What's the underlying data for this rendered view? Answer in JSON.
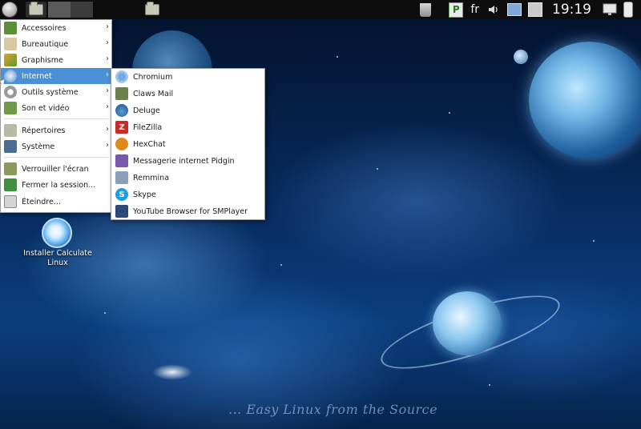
{
  "taskbar": {
    "language": "fr",
    "clock": "19:19"
  },
  "main_menu": {
    "items": [
      {
        "label": "Accessoires",
        "icon": "accessories-icon"
      },
      {
        "label": "Bureautique",
        "icon": "office-icon"
      },
      {
        "label": "Graphisme",
        "icon": "graphics-icon"
      },
      {
        "label": "Internet",
        "icon": "internet-icon"
      },
      {
        "label": "Outils système",
        "icon": "system-tools-icon"
      },
      {
        "label": "Son et vidéo",
        "icon": "multimedia-icon"
      },
      {
        "label": "Répertoires",
        "icon": "folders-icon"
      },
      {
        "label": "Système",
        "icon": "system-icon"
      },
      {
        "label": "Verrouiller l'écran",
        "icon": "lock-screen-icon"
      },
      {
        "label": "Fermer la session...",
        "icon": "logout-icon"
      },
      {
        "label": "Éteindre...",
        "icon": "shutdown-icon"
      }
    ]
  },
  "internet_submenu": {
    "items": [
      {
        "label": "Chromium",
        "icon": "chromium-icon"
      },
      {
        "label": "Claws Mail",
        "icon": "claws-mail-icon"
      },
      {
        "label": "Deluge",
        "icon": "deluge-icon"
      },
      {
        "label": "FileZilla",
        "icon": "filezilla-icon"
      },
      {
        "label": "HexChat",
        "icon": "hexchat-icon"
      },
      {
        "label": "Messagerie internet Pidgin",
        "icon": "pidgin-icon"
      },
      {
        "label": "Remmina",
        "icon": "remmina-icon"
      },
      {
        "label": "Skype",
        "icon": "skype-icon"
      },
      {
        "label": "YouTube Browser for SMPlayer",
        "icon": "smplayer-youtube-icon"
      }
    ]
  },
  "desktop": {
    "icon_label_line1": "Installer Calculate",
    "icon_label_line2": "Linux",
    "watermark": "... Easy Linux from the Source"
  },
  "colors": {
    "menu_highlight": "#4a90d9",
    "taskbar_bg": "#0d0d0d"
  }
}
